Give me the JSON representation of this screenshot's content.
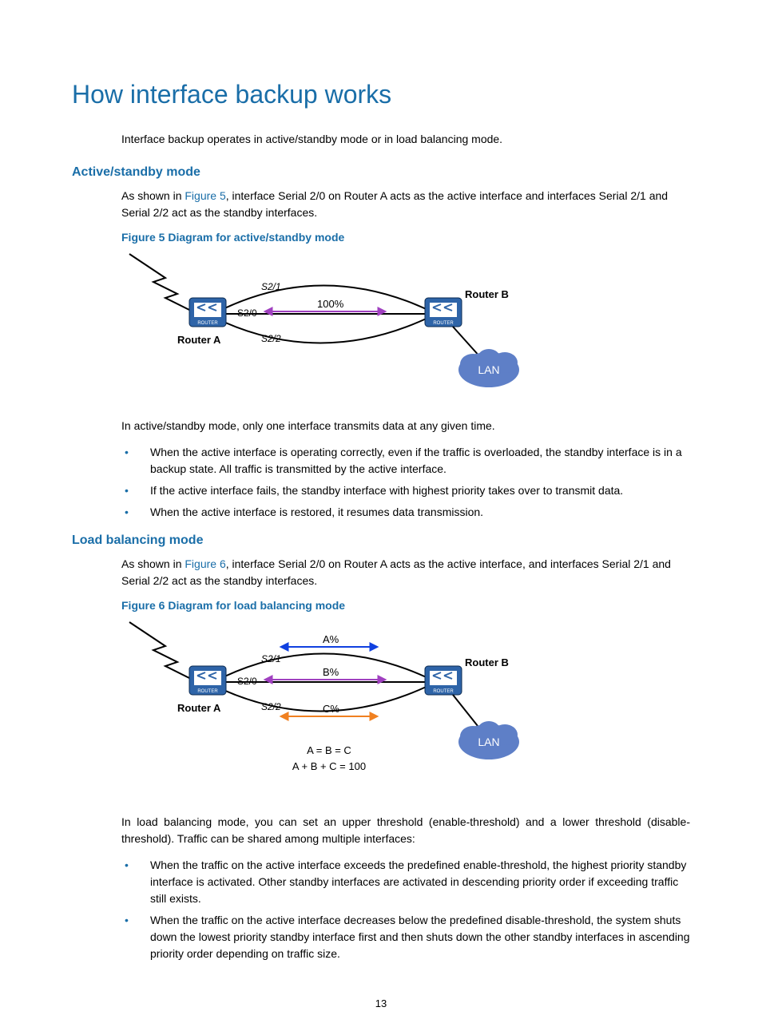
{
  "title": "How interface backup works",
  "intro": "Interface backup operates in active/standby mode or in load balancing mode.",
  "section_active": {
    "heading": "Active/standby mode",
    "para1_pre": "As shown in ",
    "para1_link": "Figure 5",
    "para1_post": ", interface Serial 2/0 on Router A acts as the active interface and interfaces Serial 2/1 and Serial 2/2 act as the standby interfaces.",
    "fig_caption": "Figure 5 Diagram for active/standby mode",
    "fig_labels": {
      "s21": "S2/1",
      "s20": "S2/0",
      "s22": "S2/2",
      "pct": "100%",
      "routerA": "Router A",
      "routerB": "Router B",
      "lan": "LAN"
    },
    "para2": "In active/standby mode, only one interface transmits data at any given time.",
    "bullets": [
      "When the active interface is operating correctly, even if the traffic is overloaded, the standby interface is in a backup state. All traffic is transmitted by the active interface.",
      "If the active interface fails, the standby interface with highest priority takes over to transmit data.",
      "When the active interface is restored, it resumes data transmission."
    ]
  },
  "section_load": {
    "heading": "Load balancing mode",
    "para1_pre": "As shown in ",
    "para1_link": "Figure 6",
    "para1_post": ", interface Serial 2/0 on Router A acts as the active interface, and interfaces Serial 2/1 and Serial 2/2 act as the standby interfaces.",
    "fig_caption": "Figure 6 Diagram for load balancing mode",
    "fig_labels": {
      "s21": "S2/1",
      "s20": "S2/0",
      "s22": "S2/2",
      "a": "A%",
      "b": "B%",
      "c": "C%",
      "eq1": "A = B = C",
      "eq2": "A + B + C = 100",
      "routerA": "Router A",
      "routerB": "Router B",
      "lan": "LAN"
    },
    "para2": "In load balancing mode, you can set an upper threshold (enable-threshold) and a lower threshold (disable-threshold). Traffic can be shared among multiple interfaces:",
    "bullets": [
      "When the traffic on the active interface exceeds the predefined enable-threshold, the highest priority standby interface is activated. Other standby interfaces are activated in descending priority order if exceeding traffic still exists.",
      "When the traffic on the active interface decreases below the predefined disable-threshold, the system shuts down the lowest priority standby interface first and then shuts down the other standby interfaces in ascending priority order depending on traffic size."
    ]
  },
  "page_number": "13"
}
